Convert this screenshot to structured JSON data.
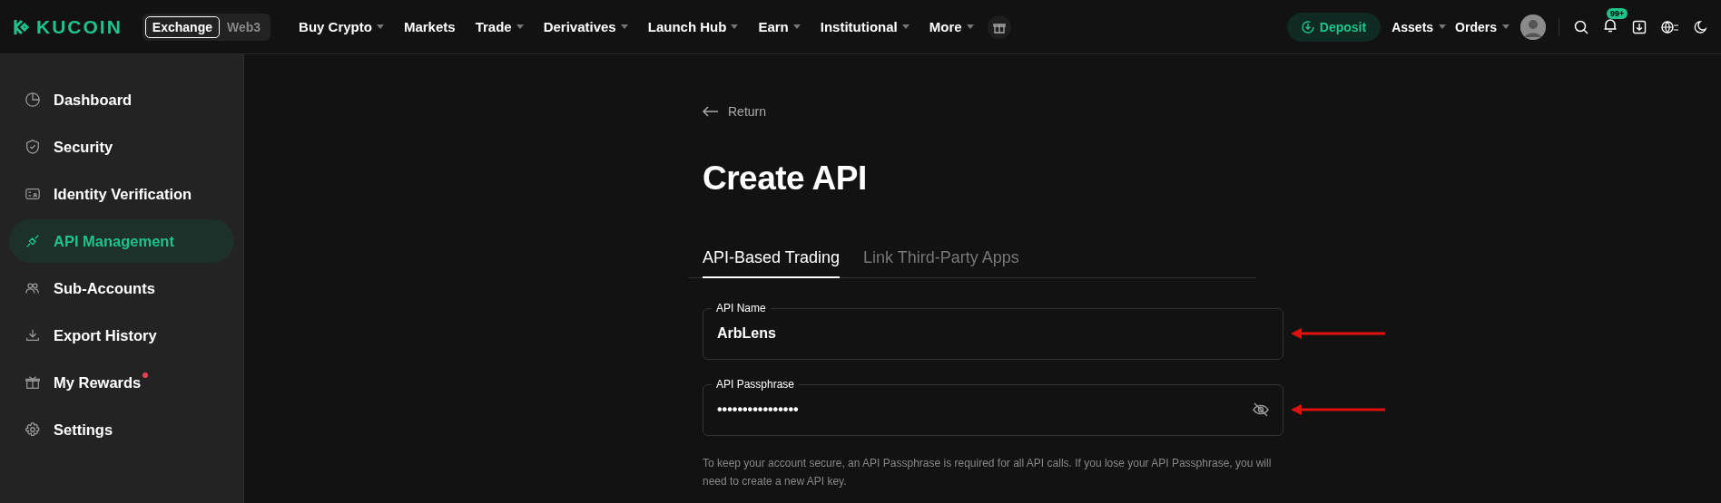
{
  "brand": {
    "name": "KUCOIN"
  },
  "mode_switch": [
    {
      "label": "Exchange",
      "selected": true
    },
    {
      "label": "Web3",
      "selected": false
    }
  ],
  "nav": [
    {
      "label": "Buy Crypto",
      "dropdown": true
    },
    {
      "label": "Markets",
      "dropdown": false
    },
    {
      "label": "Trade",
      "dropdown": true
    },
    {
      "label": "Derivatives",
      "dropdown": true
    },
    {
      "label": "Launch Hub",
      "dropdown": true
    },
    {
      "label": "Earn",
      "dropdown": true
    },
    {
      "label": "Institutional",
      "dropdown": true
    },
    {
      "label": "More",
      "dropdown": true
    }
  ],
  "header_right": {
    "deposit": "Deposit",
    "menus": [
      {
        "label": "Assets",
        "dropdown": true
      },
      {
        "label": "Orders",
        "dropdown": true
      }
    ],
    "notification_badge": "99+"
  },
  "sidebar": {
    "items": [
      {
        "label": "Dashboard",
        "selected": false,
        "dot": false
      },
      {
        "label": "Security",
        "selected": false,
        "dot": false
      },
      {
        "label": "Identity Verification",
        "selected": false,
        "dot": false
      },
      {
        "label": "API Management",
        "selected": true,
        "dot": false
      },
      {
        "label": "Sub-Accounts",
        "selected": false,
        "dot": false
      },
      {
        "label": "Export History",
        "selected": false,
        "dot": false
      },
      {
        "label": "My Rewards",
        "selected": false,
        "dot": true
      },
      {
        "label": "Settings",
        "selected": false,
        "dot": false
      }
    ]
  },
  "page": {
    "back": "Return",
    "title": "Create API",
    "tabs": [
      {
        "label": "API-Based Trading",
        "selected": true
      },
      {
        "label": "Link Third-Party Apps",
        "selected": false
      }
    ],
    "fields": [
      {
        "label": "API Name",
        "value": "ArbLens",
        "kind": "text",
        "annotated": true
      },
      {
        "label": "API Passphrase",
        "value": "••••••••••••••••",
        "kind": "password",
        "annotated": true
      }
    ],
    "help": "To keep your account secure, an API Passphrase is required for all API calls. If you lose your API Passphrase, you will need to create a new API key."
  }
}
